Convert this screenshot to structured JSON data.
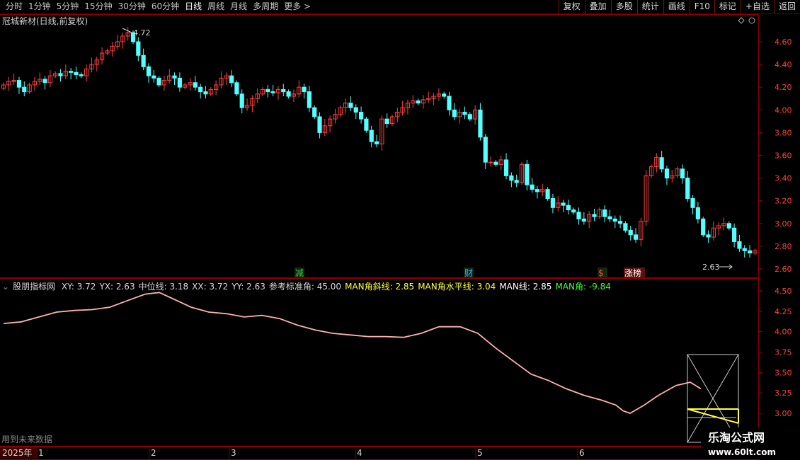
{
  "toolbar": {
    "periods": [
      "分时",
      "1分钟",
      "5分钟",
      "15分钟",
      "30分钟",
      "60分钟",
      "日线",
      "周线",
      "月线",
      "多周期",
      "更多 >"
    ],
    "active_period": "日线",
    "tools": [
      "复权",
      "叠加",
      "多股",
      "统计",
      "画线",
      "F10",
      "标记",
      "+自选",
      "返回"
    ]
  },
  "stock": {
    "title": "冠城新材(日线,前复权)",
    "high_label": "4.72",
    "low_label": "2.63",
    "price_ticks": [
      "4.60",
      "4.40",
      "4.20",
      "4.00",
      "3.80",
      "3.60",
      "3.40",
      "3.20",
      "3.00",
      "2.80",
      "2.60"
    ],
    "markers": [
      {
        "text": "减",
        "color": "#40c040"
      },
      {
        "text": "财",
        "color": "#4aa0ff"
      },
      {
        "text": "$",
        "color": "#ff4040"
      },
      {
        "text": "涨榜",
        "color": "#ffffff"
      }
    ],
    "colors": {
      "up": "#ff4040",
      "down": "#54ffff",
      "bg": "#000000",
      "frame": "#8a0000"
    }
  },
  "indicator": {
    "name": "股朋指标网",
    "values": [
      {
        "label": "XY: 3.72",
        "color": "#d8d8d8"
      },
      {
        "label": "YX: 2.63",
        "color": "#d8d8d8"
      },
      {
        "label": "中位线: 3.18",
        "color": "#d8d8d8"
      },
      {
        "label": "XX: 3.72",
        "color": "#d8d8d8"
      },
      {
        "label": "YY: 2.63",
        "color": "#d8d8d8"
      },
      {
        "label": "参考标准角: 45.00",
        "color": "#d8d8d8"
      },
      {
        "label": "MAN角斜线: 2.85",
        "color": "#ffff40"
      },
      {
        "label": "MAN角水平线: 3.04",
        "color": "#ffff40"
      },
      {
        "label": "MAN线: 2.85",
        "color": "#ffffff"
      },
      {
        "label": "MAN角: -9.84",
        "color": "#40ff40"
      }
    ],
    "ticks": [
      "4.50",
      "4.25",
      "4.00",
      "3.75",
      "3.50",
      "3.25",
      "3.00"
    ],
    "line_color": "#ffb0b0"
  },
  "footer": {
    "future_label": "用到未来数据",
    "year": "2025年",
    "months": [
      "1",
      "2",
      "3",
      "4",
      "5",
      "6"
    ]
  },
  "watermark": {
    "line1": "乐淘公式网",
    "line2": "www.60lt.com"
  }
}
